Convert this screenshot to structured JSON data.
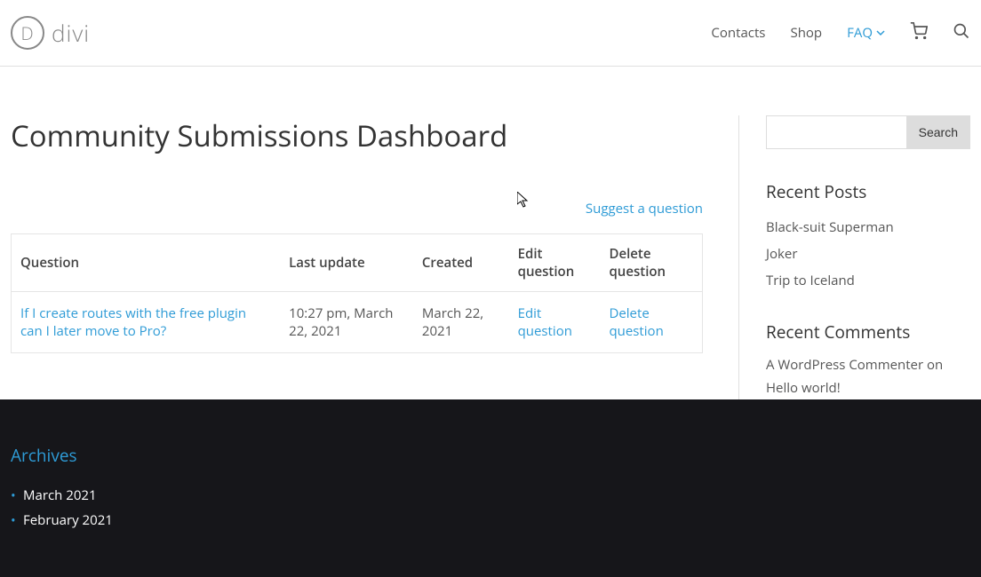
{
  "header": {
    "logo_text": "divi",
    "logo_letter": "D",
    "nav": {
      "contacts": "Contacts",
      "shop": "Shop",
      "faq": "FAQ"
    }
  },
  "main": {
    "title": "Community Submissions Dashboard",
    "suggest_link": "Suggest a question",
    "table": {
      "headers": {
        "question": "Question",
        "last_update": "Last update",
        "created": "Created",
        "edit": "Edit question",
        "delete": "Delete question"
      },
      "rows": [
        {
          "question": "If I create routes with the free plugin can I later move to Pro?",
          "last_update": "10:27 pm, March 22, 2021",
          "created": "March 22, 2021",
          "edit": "Edit question",
          "delete": "Delete question"
        }
      ]
    }
  },
  "sidebar": {
    "search_button": "Search",
    "recent_posts": {
      "title": "Recent Posts",
      "items": [
        "Black-suit Superman",
        "Joker",
        "Trip to Iceland"
      ]
    },
    "recent_comments": {
      "title": "Recent Comments",
      "text_author": "A WordPress Commenter",
      "text_on": " on ",
      "text_post": "Hello world!"
    }
  },
  "footer": {
    "archives": {
      "title": "Archives",
      "items": [
        "March 2021",
        "February 2021"
      ]
    }
  }
}
